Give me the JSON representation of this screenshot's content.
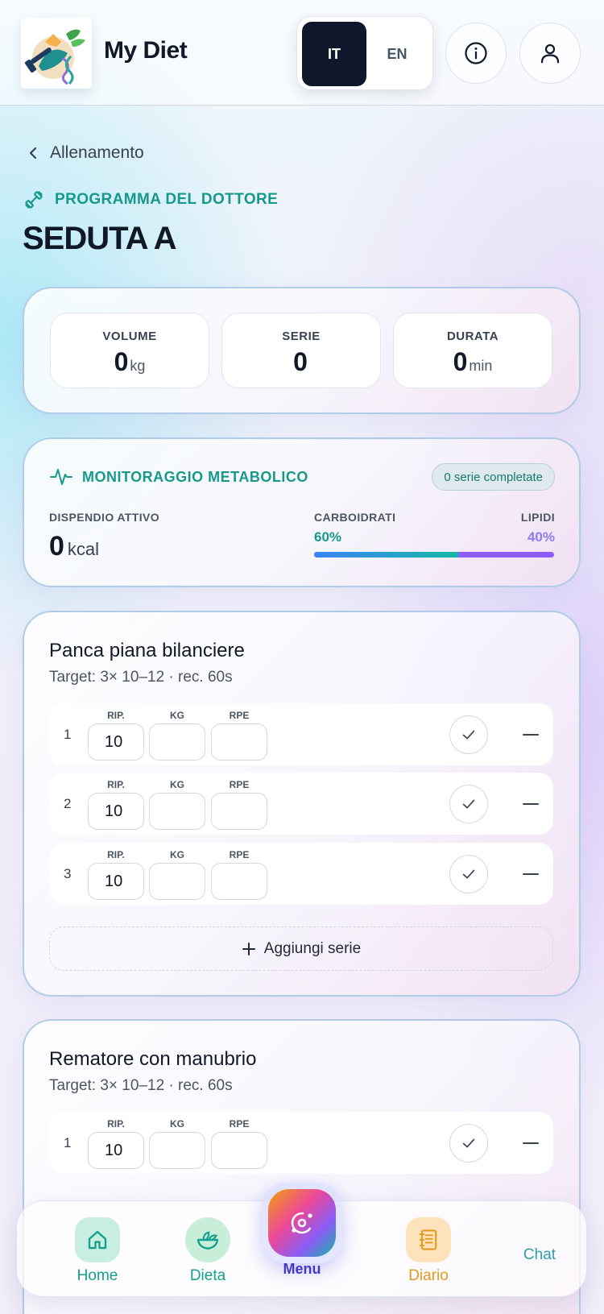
{
  "header": {
    "app_title": "My Diet",
    "lang_it": "IT",
    "lang_en": "EN",
    "active_lang": "IT"
  },
  "breadcrumb": {
    "back_label": "Allenamento"
  },
  "program_label": "PROGRAMMA DEL DOTTORE",
  "page_title": "SEDUTA A",
  "stats": [
    {
      "label": "VOLUME",
      "value": "0",
      "unit": "kg"
    },
    {
      "label": "SERIE",
      "value": "0",
      "unit": ""
    },
    {
      "label": "DURATA",
      "value": "0",
      "unit": "min"
    }
  ],
  "metabolic": {
    "title": "MONITORAGGIO METABOLICO",
    "badge": "0 serie completate",
    "spend_label": "DISPENDIO ATTIVO",
    "spend_value": "0",
    "spend_unit": "kcal",
    "carb_label": "CARBOIDRATI",
    "carb_pct": "60%",
    "lipid_label": "LIPIDI",
    "lipid_pct": "40%",
    "carb_fraction": 0.6
  },
  "exercises": [
    {
      "name": "Panca piana bilanciere",
      "target": "Target: 3× 10–12 · rec. 60s",
      "columns": {
        "reps": "RIP.",
        "kg": "KG",
        "rpe": "RPE"
      },
      "sets": [
        {
          "num": "1",
          "reps": "10",
          "kg": "",
          "rpe": ""
        },
        {
          "num": "2",
          "reps": "10",
          "kg": "",
          "rpe": ""
        },
        {
          "num": "3",
          "reps": "10",
          "kg": "",
          "rpe": ""
        }
      ],
      "add_set_label": "Aggiungi serie"
    },
    {
      "name": "Rematore con manubrio",
      "target": "Target: 3× 10–12 · rec. 60s",
      "columns": {
        "reps": "RIP.",
        "kg": "KG",
        "rpe": "RPE"
      },
      "sets": [
        {
          "num": "1",
          "reps": "10",
          "kg": "",
          "rpe": ""
        }
      ]
    }
  ],
  "nav": {
    "home": "Home",
    "dieta": "Dieta",
    "menu": "Menu",
    "diario": "Diario",
    "chat": "Chat"
  },
  "colors": {
    "accent_teal": "#16998b",
    "dark": "#0f172a",
    "lipid_purple": "#8b5cf6",
    "diario_orange": "#e39a1f",
    "menu_indigo": "#4338ca"
  }
}
